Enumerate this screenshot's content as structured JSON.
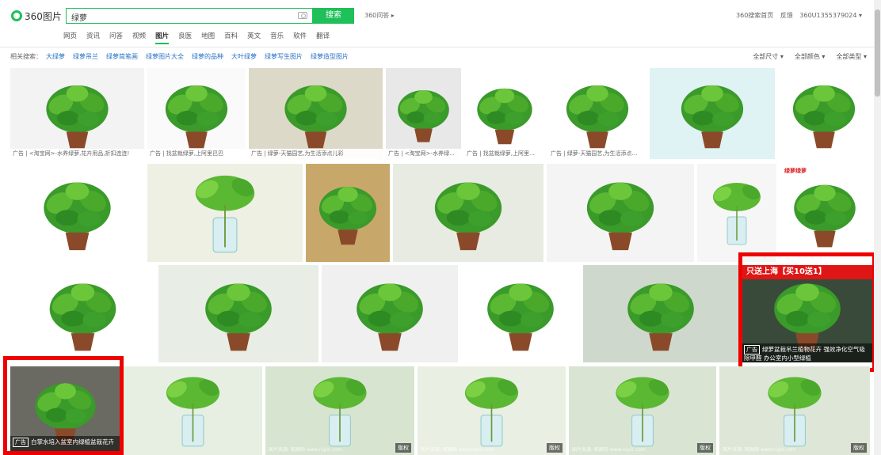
{
  "header": {
    "logo_text": "360图片",
    "search_value": "绿萝",
    "search_button": "搜索",
    "wenda_link": "360问答 ▸",
    "links": [
      "360搜索首页",
      "反馈",
      "360U1355379024 ▾"
    ]
  },
  "nav": {
    "tabs": [
      "网页",
      "资讯",
      "问答",
      "视频",
      "图片",
      "良医",
      "地图",
      "百科",
      "英文",
      "音乐",
      "软件",
      "翻译"
    ],
    "active": "图片"
  },
  "related": {
    "label": "相关搜索：",
    "keywords": [
      "大绿萝",
      "绿萝吊兰",
      "绿萝简笔画",
      "绿萝图片大全",
      "绿萝的品种",
      "大叶绿萝",
      "绿萝写生图片",
      "绿萝造型图片"
    ]
  },
  "filters": [
    "全部尺寸 ▾",
    "全部颜色 ▾",
    "全部类型 ▾"
  ],
  "images": {
    "row1_captions": [
      "广告 | <淘宝网>-水养绿萝,花卉用品,折扣连连!",
      "广告 | 找盆栽绿萝,上阿里巴巴",
      "广告 | 绿萝-天猫园艺,为生活添点儿彩",
      "广告 | <淘宝网>-水养绿...",
      "广告 | 找盆栽绿萝,上阿里...",
      "广告 | 绿萝-天猫园艺,为生活添点..."
    ],
    "r2_tag": "绿萝绿萝",
    "ad1": {
      "banner": "只送上海【买10送1】",
      "tag": "广告",
      "text": "绿萝盆栽吊兰植物花卉 强效净化空气吸除甲醛 办公室内小型绿植"
    },
    "ad2": {
      "tag": "广告",
      "text": "白掌水培入盆室内绿植盆栽花卉"
    },
    "copyright_label": "版权",
    "watermark": "图片来源: 昵图网 www.nipic.com"
  },
  "colors": {
    "brand": "#1fbf5a",
    "highlight": "#ee0000",
    "link": "#2a73c5"
  }
}
